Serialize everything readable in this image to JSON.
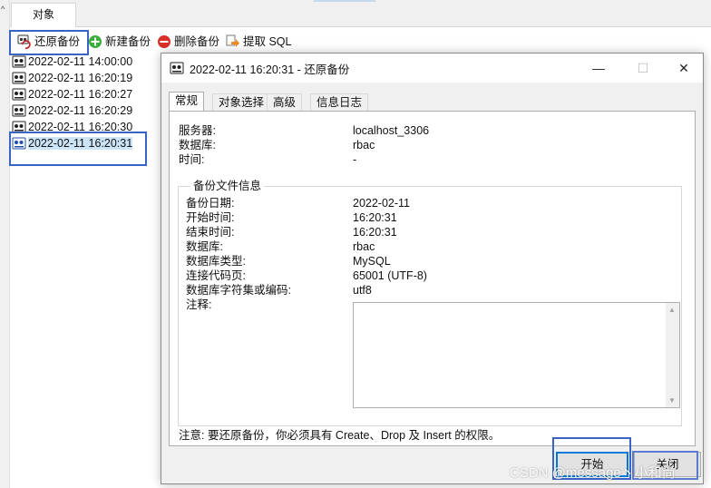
{
  "app": {
    "tab_objects": "对象",
    "toolbar": {
      "restore_backup": "还原备份",
      "new_backup": "新建备份",
      "delete_backup": "删除备份",
      "extract_sql": "提取 SQL"
    },
    "backup_list": [
      "2022-02-11 14:00:00",
      "2022-02-11 16:20:19",
      "2022-02-11 16:20:27",
      "2022-02-11 16:20:29",
      "2022-02-11 16:20:30",
      "2022-02-11 16:20:31"
    ],
    "selected_index": 5
  },
  "dialog": {
    "title": "2022-02-11 16:20:31 - 还原备份",
    "window_controls": {
      "minimize": "—",
      "maximize": "☐",
      "close": "✕"
    },
    "tabs": [
      "常规",
      "对象选择",
      "高级",
      "信息日志"
    ],
    "active_tab": 0,
    "general": {
      "server_label": "服务器:",
      "server_value": "localhost_3306",
      "database_label": "数据库:",
      "database_value": "rbac",
      "time_label": "时间:",
      "time_value": "-"
    },
    "backup_info": {
      "group_title": "备份文件信息",
      "date_label": "备份日期:",
      "date_value": "2022-02-11",
      "start_label": "开始时间:",
      "start_value": "16:20:31",
      "end_label": "结束时间:",
      "end_value": "16:20:31",
      "db_label": "数据库:",
      "db_value": "rbac",
      "db_type_label": "数据库类型:",
      "db_type_value": "MySQL",
      "codepage_label": "连接代码页:",
      "codepage_value": "65001 (UTF-8)",
      "charset_label": "数据库字符集或编码:",
      "charset_value": "utf8",
      "notes_label": "注释:",
      "notes_value": ""
    },
    "warning": "注意: 要还原备份，你必须具有 Create、Drop 及 Insert 的权限。",
    "start_button": "开始",
    "close_button": "关闭"
  },
  "watermark": "CSDN @message丶小和尚",
  "colors": {
    "highlight_box": "#3b63c4",
    "selection": "#cce4f7",
    "dialog_bg": "#f0f0f0"
  }
}
